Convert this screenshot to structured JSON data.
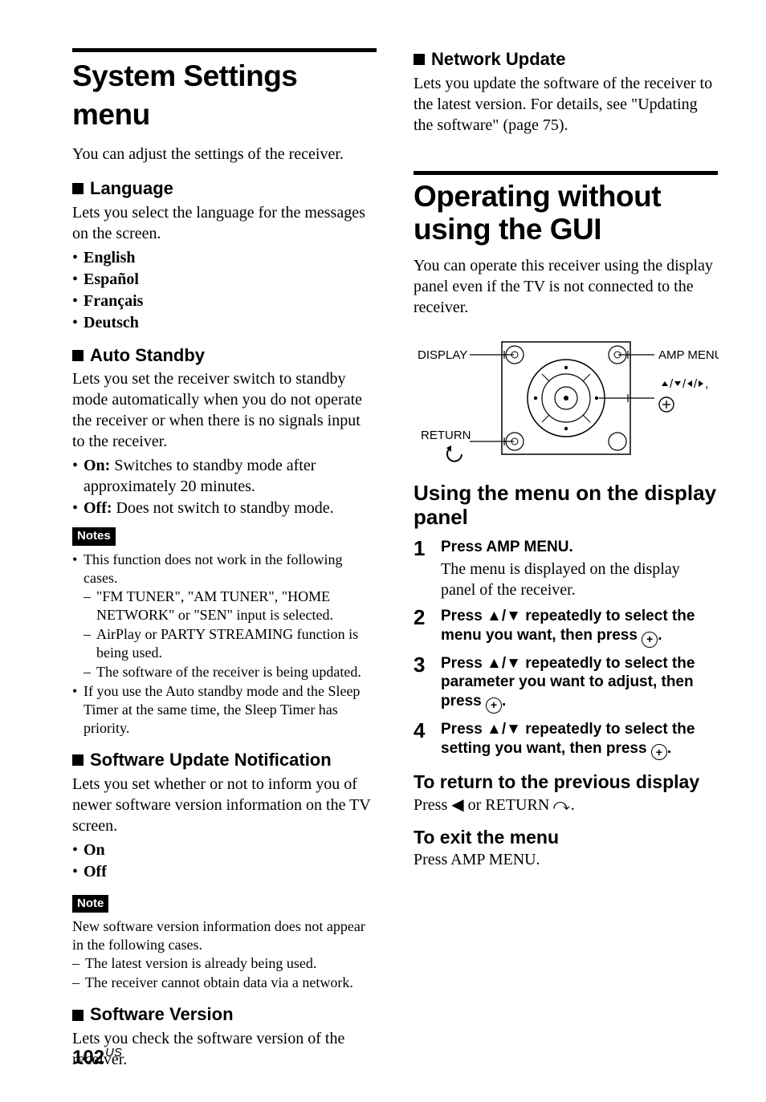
{
  "left": {
    "title": "System Settings menu",
    "intro": "You can adjust the settings of the receiver.",
    "language": {
      "heading": "Language",
      "desc": "Lets you select the language for the messages on the screen.",
      "options": [
        "English",
        "Español",
        "Français",
        "Deutsch"
      ]
    },
    "auto_standby": {
      "heading": "Auto Standby",
      "desc": "Lets you set the receiver switch to standby mode automatically when you do not operate the receiver or when there is no signals input to the receiver.",
      "options": [
        {
          "name": "On:",
          "desc": " Switches to standby mode after approximately 20 minutes."
        },
        {
          "name": "Off:",
          "desc": " Does not switch to standby mode."
        }
      ],
      "notes_label": "Notes",
      "notes": {
        "lead": "This function does not work in the following cases.",
        "cases": [
          "\"FM TUNER\", \"AM TUNER\", \"HOME NETWORK\" or \"SEN\" input is selected.",
          "AirPlay or PARTY STREAMING function is being used.",
          "The software of the receiver is being updated."
        ],
        "extra": "If you use the Auto standby mode and the Sleep Timer at the same time, the Sleep Timer has priority."
      }
    },
    "sw_update_notif": {
      "heading": "Software Update Notification",
      "desc": "Lets you set whether or not to inform you of newer software version information on the TV screen.",
      "options": [
        "On",
        "Off"
      ],
      "note_label": "Note",
      "note_lead": "New software version information does not appear in the following cases.",
      "note_cases": [
        "The latest version is already being used.",
        "The receiver cannot obtain data via a network."
      ]
    },
    "sw_version": {
      "heading": "Software Version",
      "desc": "Lets you check the software version of the receiver."
    }
  },
  "right": {
    "network_update": {
      "heading": "Network Update",
      "desc": "Lets you update the software of the receiver to the latest version. For details, see \"Updating the software\" (page 75)."
    },
    "gui_title": "Operating without using the GUI",
    "gui_intro": "You can operate this receiver using the display panel even if the TV is not connected to the receiver.",
    "diagram": {
      "display": "DISPLAY",
      "amp_menu": "AMP MENU",
      "return": "RETURN",
      "arrows_suffix": ","
    },
    "menu_title": "Using the menu on the display panel",
    "steps": [
      {
        "num": "1",
        "head": "Press AMP MENU.",
        "desc": "The menu is displayed on the display panel of the receiver."
      },
      {
        "num": "2",
        "head_a": "Press ",
        "head_b": " repeatedly to select the menu you want, then press ",
        "head_c": "."
      },
      {
        "num": "3",
        "head_a": "Press ",
        "head_b": " repeatedly to select the parameter you want to adjust, then press ",
        "head_c": "."
      },
      {
        "num": "4",
        "head_a": "Press ",
        "head_b": " repeatedly to select the setting you want, then press ",
        "head_c": "."
      }
    ],
    "return_title": "To return to the previous display",
    "return_body_a": "Press ",
    "return_body_b": " or RETURN ",
    "return_body_c": ".",
    "exit_title": "To exit the menu",
    "exit_body": "Press AMP MENU."
  },
  "page": {
    "num": "102",
    "region": "US"
  }
}
